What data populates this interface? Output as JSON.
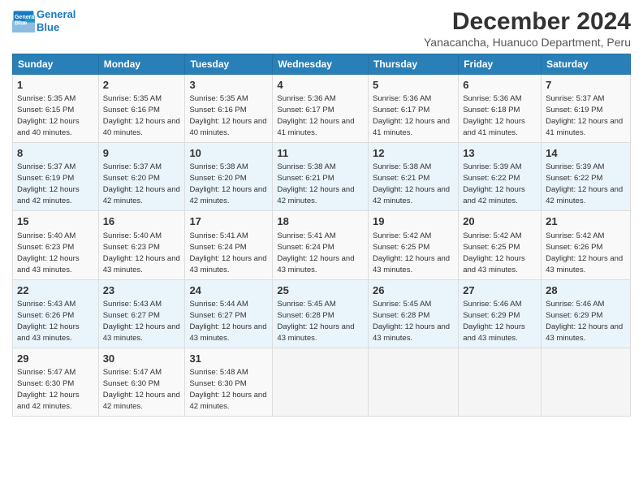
{
  "logo": {
    "line1": "General",
    "line2": "Blue"
  },
  "title": "December 2024",
  "subtitle": "Yanacancha, Huanuco Department, Peru",
  "days_of_week": [
    "Sunday",
    "Monday",
    "Tuesday",
    "Wednesday",
    "Thursday",
    "Friday",
    "Saturday"
  ],
  "weeks": [
    [
      {
        "day": "1",
        "sunrise": "Sunrise: 5:35 AM",
        "sunset": "Sunset: 6:15 PM",
        "daylight": "Daylight: 12 hours and 40 minutes."
      },
      {
        "day": "2",
        "sunrise": "Sunrise: 5:35 AM",
        "sunset": "Sunset: 6:16 PM",
        "daylight": "Daylight: 12 hours and 40 minutes."
      },
      {
        "day": "3",
        "sunrise": "Sunrise: 5:35 AM",
        "sunset": "Sunset: 6:16 PM",
        "daylight": "Daylight: 12 hours and 40 minutes."
      },
      {
        "day": "4",
        "sunrise": "Sunrise: 5:36 AM",
        "sunset": "Sunset: 6:17 PM",
        "daylight": "Daylight: 12 hours and 41 minutes."
      },
      {
        "day": "5",
        "sunrise": "Sunrise: 5:36 AM",
        "sunset": "Sunset: 6:17 PM",
        "daylight": "Daylight: 12 hours and 41 minutes."
      },
      {
        "day": "6",
        "sunrise": "Sunrise: 5:36 AM",
        "sunset": "Sunset: 6:18 PM",
        "daylight": "Daylight: 12 hours and 41 minutes."
      },
      {
        "day": "7",
        "sunrise": "Sunrise: 5:37 AM",
        "sunset": "Sunset: 6:19 PM",
        "daylight": "Daylight: 12 hours and 41 minutes."
      }
    ],
    [
      {
        "day": "8",
        "sunrise": "Sunrise: 5:37 AM",
        "sunset": "Sunset: 6:19 PM",
        "daylight": "Daylight: 12 hours and 42 minutes."
      },
      {
        "day": "9",
        "sunrise": "Sunrise: 5:37 AM",
        "sunset": "Sunset: 6:20 PM",
        "daylight": "Daylight: 12 hours and 42 minutes."
      },
      {
        "day": "10",
        "sunrise": "Sunrise: 5:38 AM",
        "sunset": "Sunset: 6:20 PM",
        "daylight": "Daylight: 12 hours and 42 minutes."
      },
      {
        "day": "11",
        "sunrise": "Sunrise: 5:38 AM",
        "sunset": "Sunset: 6:21 PM",
        "daylight": "Daylight: 12 hours and 42 minutes."
      },
      {
        "day": "12",
        "sunrise": "Sunrise: 5:38 AM",
        "sunset": "Sunset: 6:21 PM",
        "daylight": "Daylight: 12 hours and 42 minutes."
      },
      {
        "day": "13",
        "sunrise": "Sunrise: 5:39 AM",
        "sunset": "Sunset: 6:22 PM",
        "daylight": "Daylight: 12 hours and 42 minutes."
      },
      {
        "day": "14",
        "sunrise": "Sunrise: 5:39 AM",
        "sunset": "Sunset: 6:22 PM",
        "daylight": "Daylight: 12 hours and 42 minutes."
      }
    ],
    [
      {
        "day": "15",
        "sunrise": "Sunrise: 5:40 AM",
        "sunset": "Sunset: 6:23 PM",
        "daylight": "Daylight: 12 hours and 43 minutes."
      },
      {
        "day": "16",
        "sunrise": "Sunrise: 5:40 AM",
        "sunset": "Sunset: 6:23 PM",
        "daylight": "Daylight: 12 hours and 43 minutes."
      },
      {
        "day": "17",
        "sunrise": "Sunrise: 5:41 AM",
        "sunset": "Sunset: 6:24 PM",
        "daylight": "Daylight: 12 hours and 43 minutes."
      },
      {
        "day": "18",
        "sunrise": "Sunrise: 5:41 AM",
        "sunset": "Sunset: 6:24 PM",
        "daylight": "Daylight: 12 hours and 43 minutes."
      },
      {
        "day": "19",
        "sunrise": "Sunrise: 5:42 AM",
        "sunset": "Sunset: 6:25 PM",
        "daylight": "Daylight: 12 hours and 43 minutes."
      },
      {
        "day": "20",
        "sunrise": "Sunrise: 5:42 AM",
        "sunset": "Sunset: 6:25 PM",
        "daylight": "Daylight: 12 hours and 43 minutes."
      },
      {
        "day": "21",
        "sunrise": "Sunrise: 5:42 AM",
        "sunset": "Sunset: 6:26 PM",
        "daylight": "Daylight: 12 hours and 43 minutes."
      }
    ],
    [
      {
        "day": "22",
        "sunrise": "Sunrise: 5:43 AM",
        "sunset": "Sunset: 6:26 PM",
        "daylight": "Daylight: 12 hours and 43 minutes."
      },
      {
        "day": "23",
        "sunrise": "Sunrise: 5:43 AM",
        "sunset": "Sunset: 6:27 PM",
        "daylight": "Daylight: 12 hours and 43 minutes."
      },
      {
        "day": "24",
        "sunrise": "Sunrise: 5:44 AM",
        "sunset": "Sunset: 6:27 PM",
        "daylight": "Daylight: 12 hours and 43 minutes."
      },
      {
        "day": "25",
        "sunrise": "Sunrise: 5:45 AM",
        "sunset": "Sunset: 6:28 PM",
        "daylight": "Daylight: 12 hours and 43 minutes."
      },
      {
        "day": "26",
        "sunrise": "Sunrise: 5:45 AM",
        "sunset": "Sunset: 6:28 PM",
        "daylight": "Daylight: 12 hours and 43 minutes."
      },
      {
        "day": "27",
        "sunrise": "Sunrise: 5:46 AM",
        "sunset": "Sunset: 6:29 PM",
        "daylight": "Daylight: 12 hours and 43 minutes."
      },
      {
        "day": "28",
        "sunrise": "Sunrise: 5:46 AM",
        "sunset": "Sunset: 6:29 PM",
        "daylight": "Daylight: 12 hours and 43 minutes."
      }
    ],
    [
      {
        "day": "29",
        "sunrise": "Sunrise: 5:47 AM",
        "sunset": "Sunset: 6:30 PM",
        "daylight": "Daylight: 12 hours and 42 minutes."
      },
      {
        "day": "30",
        "sunrise": "Sunrise: 5:47 AM",
        "sunset": "Sunset: 6:30 PM",
        "daylight": "Daylight: 12 hours and 42 minutes."
      },
      {
        "day": "31",
        "sunrise": "Sunrise: 5:48 AM",
        "sunset": "Sunset: 6:30 PM",
        "daylight": "Daylight: 12 hours and 42 minutes."
      },
      null,
      null,
      null,
      null
    ]
  ]
}
